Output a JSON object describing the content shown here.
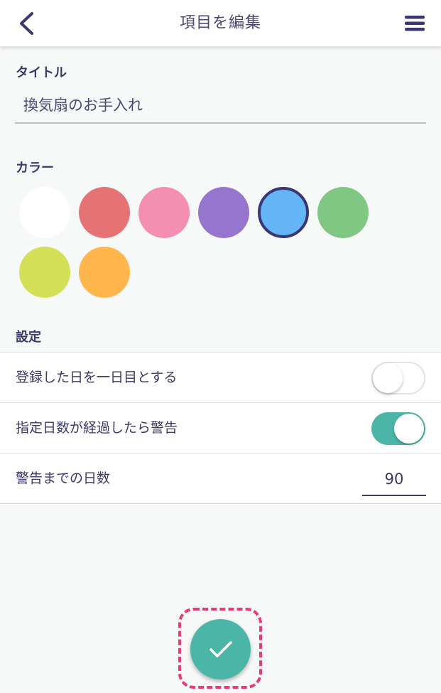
{
  "header": {
    "title": "項目を編集"
  },
  "title_section": {
    "label": "タイトル",
    "value": "換気扇のお手入れ"
  },
  "color_section": {
    "label": "カラー",
    "selected_index": 4,
    "swatches": [
      {
        "name": "white",
        "hex": "#ffffff"
      },
      {
        "name": "red",
        "hex": "#e57373"
      },
      {
        "name": "pink",
        "hex": "#f48fb1"
      },
      {
        "name": "purple",
        "hex": "#9575cd"
      },
      {
        "name": "blue",
        "hex": "#64b5f6"
      },
      {
        "name": "green",
        "hex": "#81c784"
      },
      {
        "name": "lime",
        "hex": "#d4e157"
      },
      {
        "name": "orange",
        "hex": "#ffb74d"
      }
    ]
  },
  "settings_section": {
    "label": "設定",
    "rows": [
      {
        "label": "登録した日を一日目とする",
        "toggle_on": false
      },
      {
        "label": "指定日数が経過したら警告",
        "toggle_on": true
      },
      {
        "label": "警告までの日数",
        "value": "90"
      }
    ]
  },
  "colors": {
    "accent": "#4bb6a8",
    "text": "#3d3a6b",
    "highlight": "#e83d73"
  },
  "icons": {
    "back": "chevron-left-icon",
    "menu": "hamburger-menu-icon",
    "confirm": "checkmark-icon"
  }
}
